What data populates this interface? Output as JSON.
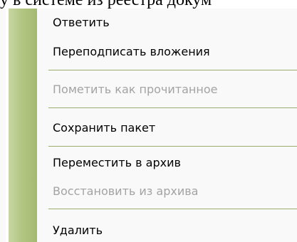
{
  "background_text": "у в системе из реестра докум",
  "menu": {
    "items": [
      {
        "label": "Ответить",
        "disabled": false
      },
      {
        "label": "Переподписать вложения",
        "disabled": false
      },
      {
        "label": "Пометить как прочитанное",
        "disabled": true
      },
      {
        "label": "Сохранить пакет",
        "disabled": false
      },
      {
        "label": "Переместить в архив",
        "disabled": false
      },
      {
        "label": "Восстановить из архива",
        "disabled": true
      },
      {
        "label": "Удалить",
        "disabled": false
      }
    ]
  },
  "colors": {
    "gutter": "#b3c684",
    "separator": "#9aab70",
    "disabled_text": "#a3a3a3"
  }
}
